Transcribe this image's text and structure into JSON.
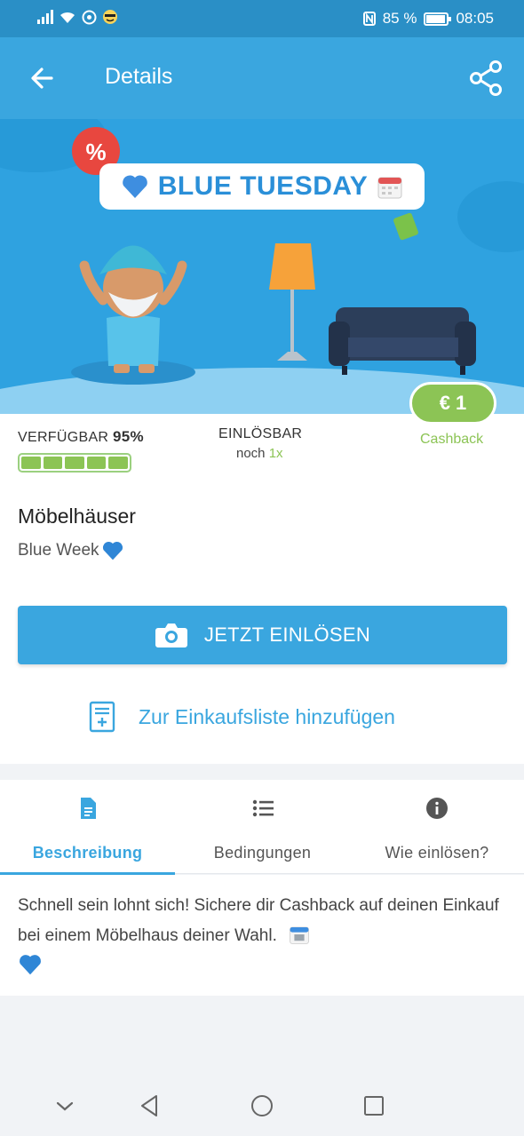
{
  "status_bar": {
    "battery": "85 %",
    "battery_level": 0.85,
    "time": "08:05"
  },
  "app_bar": {
    "title": "Details"
  },
  "banner": {
    "title": "BLUE TUESDAY",
    "badge": "%"
  },
  "offer": {
    "availability_label": "VERFÜGBAR",
    "availability_value": "95%",
    "availability_fraction": 0.95,
    "redeemable_label": "EINLÖSBAR",
    "redeemable_prefix": "noch",
    "redeemable_count": "1x",
    "cashback_amount": "€ 1",
    "cashback_label": "Cashback"
  },
  "merchant": {
    "name": "Möbelhäuser",
    "subtitle": "Blue Week"
  },
  "actions": {
    "redeem_label": "JETZT EINLÖSEN",
    "add_to_list_label": "Zur Einkaufsliste hinzufügen"
  },
  "tabs": [
    {
      "label": "Beschreibung",
      "active": true
    },
    {
      "label": "Bedingungen",
      "active": false
    },
    {
      "label": "Wie einlösen?",
      "active": false
    }
  ],
  "description": {
    "text": "Schnell sein lohnt sich! Sichere dir Cashback auf deinen Einkauf bei einem Möbelhaus deiner Wahl."
  },
  "colors": {
    "primary": "#3aa6df",
    "status_bar": "#2a8fc6",
    "accent_green": "#8cc455"
  }
}
